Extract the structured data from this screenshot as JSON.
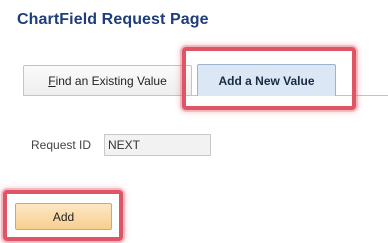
{
  "page": {
    "title": "ChartField Request Page"
  },
  "tabs": [
    {
      "accel": "F",
      "rest": "ind an Existing Value",
      "active": false
    },
    {
      "label": "Add a New Value",
      "active": true
    }
  ],
  "form": {
    "request_id_label": "Request ID",
    "request_id_value": "NEXT"
  },
  "actions": {
    "add_label": "Add"
  },
  "colors": {
    "title": "#1f3d7a",
    "highlight": "#e05565",
    "active_tab": "#dbe7f5",
    "add_button": "#f7cf8e"
  }
}
